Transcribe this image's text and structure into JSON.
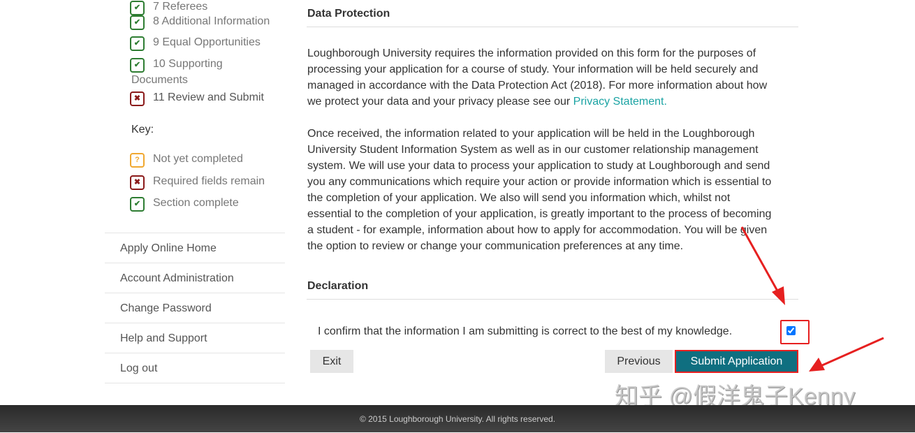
{
  "sidebar": {
    "steps": [
      {
        "label": "7 Referees",
        "status": "complete"
      },
      {
        "label": "8 Additional Information",
        "status": "complete"
      },
      {
        "label": "9 Equal Opportunities",
        "status": "complete"
      },
      {
        "label": "10 Supporting",
        "label2": "Documents",
        "status": "complete"
      },
      {
        "label": "11 Review and Submit",
        "status": "required"
      }
    ],
    "key_title": "Key:",
    "key": [
      {
        "label": "Not yet completed",
        "icon": "question-icon"
      },
      {
        "label": "Required fields remain",
        "icon": "cross-icon"
      },
      {
        "label": "Section complete",
        "icon": "check-icon"
      }
    ],
    "links": [
      "Apply Online Home",
      "Account Administration",
      "Change Password",
      "Help and Support",
      "Log out"
    ]
  },
  "main": {
    "data_protection": {
      "heading": "Data Protection",
      "para1": [
        "Loughborough University requires the information provided on this form for the purposes of",
        "processing your application for a course of study. Your information will be held securely and",
        "managed in accordance with the Data Protection Act (2018). For more information about how",
        "we protect your data and your privacy please see our "
      ],
      "privacy_link": "Privacy Statement.",
      "para2": [
        "Once received, the information related to your application will be held in the Loughborough",
        "University Student Information System as well as in our customer relationship management",
        "system. We will use your data to process your application to study at Loughborough and send",
        "you any communications which require your action or provide information which is essential to",
        "the completion of your application. We also will send you information which, whilst not",
        "essential to the completion of your application, is greatly important to the process of becoming",
        "a student - for example, information about how to apply for accommodation. You will be given",
        "the option to review or change your communication preferences at any time."
      ]
    },
    "declaration": {
      "heading": "Declaration",
      "confirm_text": "I confirm that the information I am submitting is correct to the best of my knowledge.",
      "checked": true
    },
    "buttons": {
      "exit": "Exit",
      "previous": "Previous",
      "submit": "Submit Application"
    }
  },
  "watermark": "知乎 @假洋鬼子Kenny",
  "footer": "© 2015 Loughborough University. All rights reserved.",
  "colors": {
    "accent": "#0f6f80",
    "link": "#1aa3a3",
    "complete": "#2e7d32",
    "required": "#8b1a1a",
    "pending": "#f0a830",
    "annotation": "#e62020"
  }
}
